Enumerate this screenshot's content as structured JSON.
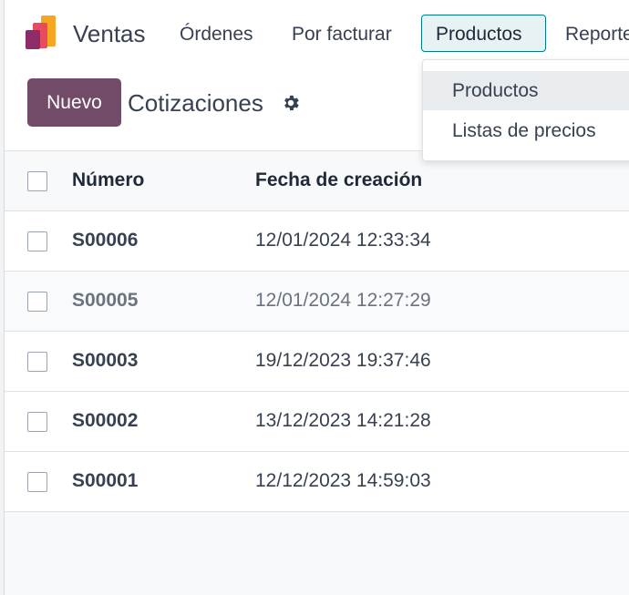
{
  "navbar": {
    "app_name": "Ventas",
    "items": [
      {
        "label": "Órdenes",
        "active": false
      },
      {
        "label": "Por facturar",
        "active": false
      },
      {
        "label": "Productos",
        "active": true
      },
      {
        "label": "Reporte",
        "active": false
      }
    ]
  },
  "dropdown": {
    "items": [
      {
        "label": "Productos",
        "highlighted": true
      },
      {
        "label": "Listas de precios",
        "highlighted": false
      }
    ]
  },
  "control": {
    "new_button": "Nuevo",
    "breadcrumb": "Cotizaciones",
    "settings_icon": "gear-icon"
  },
  "list": {
    "columns": [
      "Número",
      "Fecha de creación"
    ],
    "rows": [
      {
        "number": "S00006",
        "created": "12/01/2024 12:33:34"
      },
      {
        "number": "S00005",
        "created": "12/01/2024 12:27:29"
      },
      {
        "number": "S00003",
        "created": "19/12/2023 19:37:46"
      },
      {
        "number": "S00002",
        "created": "13/12/2023 14:21:28"
      },
      {
        "number": "S00001",
        "created": "12/12/2023 14:59:03"
      }
    ]
  },
  "colors": {
    "brand": "#714b67",
    "active_border": "#017e84",
    "active_bg": "#e6f2f3"
  }
}
